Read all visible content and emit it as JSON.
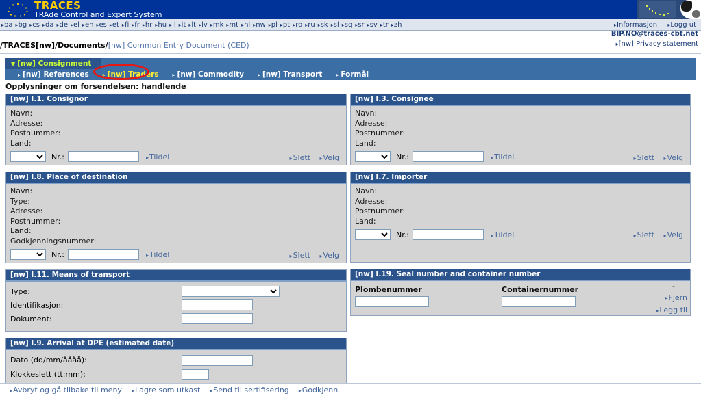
{
  "header": {
    "logo_title": "TRACES",
    "logo_subtitle": "TRAde Control and Expert System",
    "logo_icon": "eu-stars-icon",
    "banner_art_icon": "map-and-cow-image"
  },
  "languages": [
    "ba",
    "bg",
    "cs",
    "da",
    "de",
    "el",
    "en",
    "es",
    "et",
    "fi",
    "fr",
    "hr",
    "hu",
    "il",
    "it",
    "lt",
    "lv",
    "mk",
    "mt",
    "nl",
    "nw",
    "pl",
    "pt",
    "ro",
    "ru",
    "sk",
    "sl",
    "sq",
    "sr",
    "sv",
    "tr",
    "zh"
  ],
  "topright": {
    "info_label": "Informasjon",
    "logout_label": "Logg ut",
    "account_email": "BIP.NO@traces-cbt.net",
    "privacy_label": "[nw] Privacy statement"
  },
  "breadcrumb": {
    "root": "/TRACES[nw]",
    "section": "/Documents/",
    "current": "[nw] Common Entry Document (CED)"
  },
  "tabs": {
    "main_tab": "[nw] Consignment",
    "subtabs": [
      {
        "label": "[nw] References",
        "active": false
      },
      {
        "label": "[nw] Traders",
        "active": true
      },
      {
        "label": "[nw] Commodity",
        "active": false
      },
      {
        "label": "[nw] Transport",
        "active": false
      },
      {
        "label": "Formål",
        "active": false
      }
    ]
  },
  "section_title": "Opplysninger om forsendelsen: handlende",
  "common": {
    "nr_label": "Nr.:",
    "tildel": "Tildel",
    "slett": "Slett",
    "velg": "Velg",
    "nr_value": "",
    "select_value": ""
  },
  "panels": {
    "consignor": {
      "title": "[nw] I.1. Consignor",
      "fields": [
        "Navn:",
        "Adresse:",
        "Postnummer:",
        "Land:"
      ]
    },
    "consignee": {
      "title": "[nw] I.3. Consignee",
      "fields": [
        "Navn:",
        "Adresse:",
        "Postnummer:",
        "Land:"
      ]
    },
    "destination": {
      "title": "[nw] I.8. Place of destination",
      "fields": [
        "Navn:",
        "Type:",
        "Adresse:",
        "Postnummer:",
        "Land:",
        "Godkjenningsnummer:"
      ]
    },
    "importer": {
      "title": "[nw] I.7. Importer",
      "fields": [
        "Navn:",
        "Adresse:",
        "Postnummer:",
        "Land:"
      ]
    },
    "transport": {
      "title": "[nw] I.11. Means of transport",
      "type_label": "Type:",
      "type_value": "",
      "ident_label": "Identifikasjon:",
      "ident_value": "",
      "dokument_label": "Dokument:",
      "dokument_value": ""
    },
    "seal": {
      "title": "[nw] I.19. Seal number and container number",
      "col1_header": "Plombenummer",
      "col2_header": "Containernummer",
      "col1_value": "",
      "col2_value": "",
      "minus_label": "-",
      "remove_label": "Fjern",
      "add_label": "Legg til"
    },
    "arrival": {
      "title": "[nw] I.9. Arrival at DPE (estimated date)",
      "date_label": "Dato (dd/mm/åååå):",
      "date_value": "",
      "time_label": "Klokkeslett (tt:mm):",
      "time_value": ""
    }
  },
  "actions": [
    "Avbryt og gå tilbake til meny",
    "Lagre som utkast",
    "Send til sertifisering",
    "Godkjenn"
  ],
  "colors": {
    "eu_blue": "#003399",
    "eu_yellow": "#ffcc00",
    "panel_header": "#2c548c",
    "tab_bar": "#3a6ea5",
    "active_tab_text": "#ffee33",
    "link_blue": "#44679c",
    "annotation_red": "#e8170f"
  },
  "annotation": {
    "shape": "ellipse",
    "target": "[nw] Traders"
  }
}
